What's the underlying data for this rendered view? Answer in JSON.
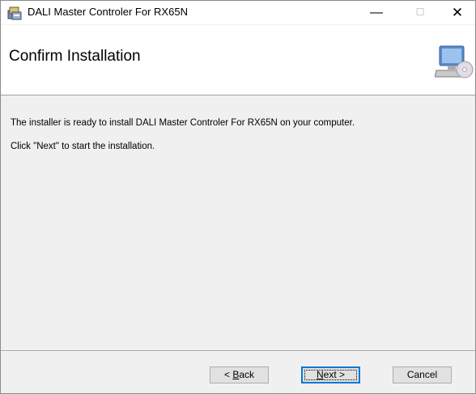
{
  "window": {
    "title": "DALI Master Controler For RX65N",
    "controls": {
      "minimize": "—",
      "maximize": "☐",
      "close": "✕"
    }
  },
  "banner": {
    "heading": "Confirm Installation",
    "icon": "computer-cd-icon"
  },
  "content": {
    "line1": "The installer is ready to install DALI Master Controler For RX65N on your computer.",
    "line2": "Click \"Next\" to start the installation."
  },
  "buttons": {
    "back_prefix": "< ",
    "back_mnemonic": "B",
    "back_rest": "ack",
    "next_mnemonic": "N",
    "next_rest": "ext >",
    "cancel": "Cancel"
  },
  "colors": {
    "focus_border": "#0078d7",
    "background": "#f0f0f0"
  }
}
